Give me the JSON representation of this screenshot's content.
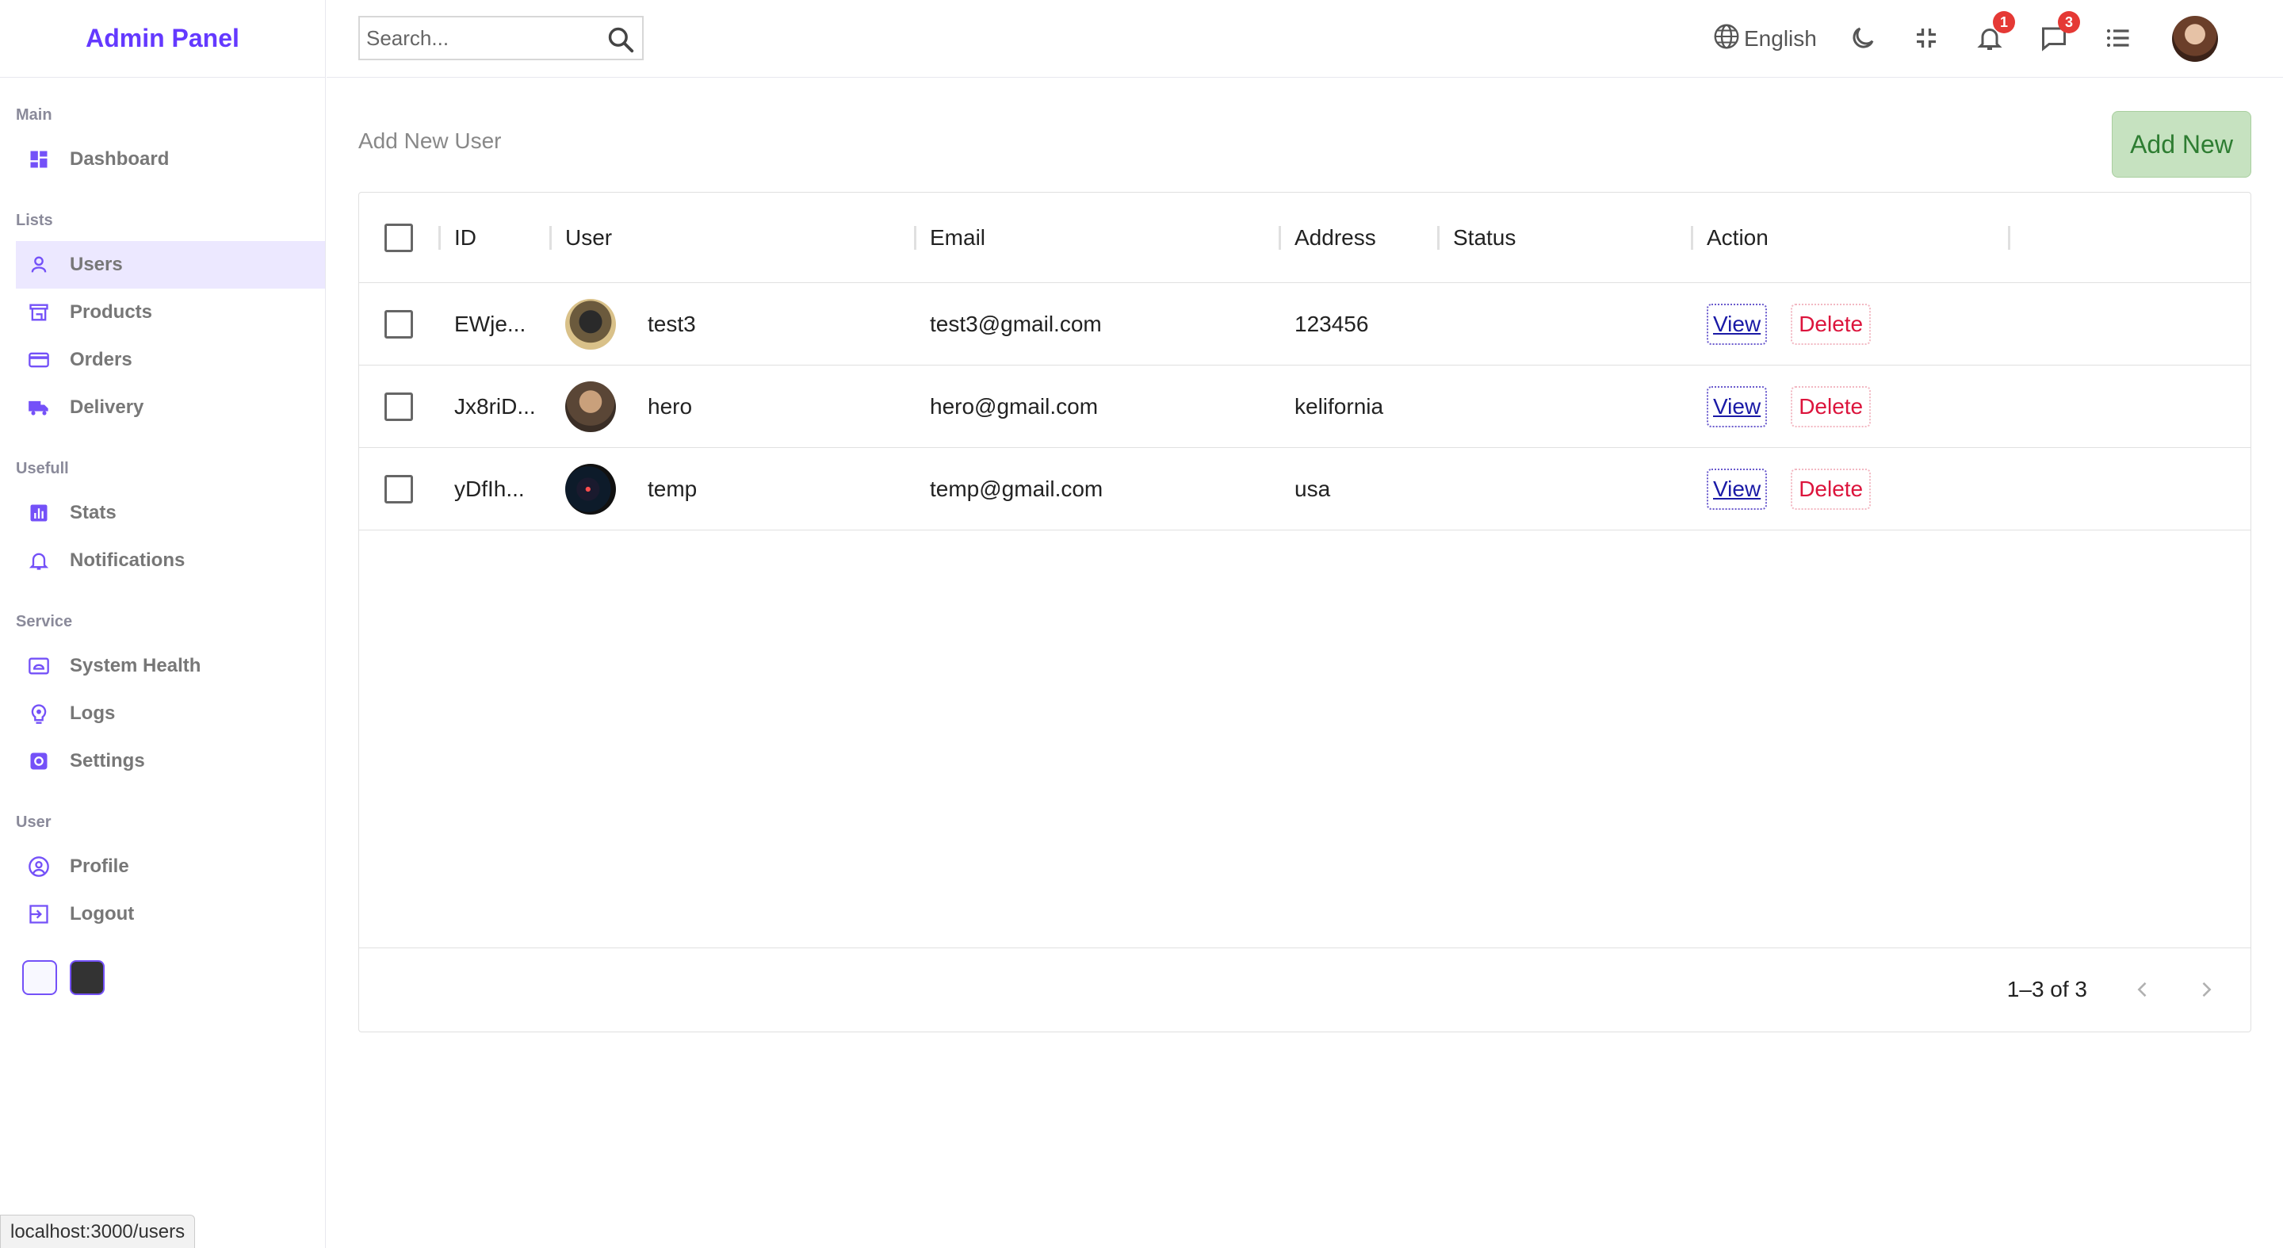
{
  "app": {
    "title": "Admin Panel"
  },
  "colors": {
    "accent": "#6439ff",
    "add_new_bg": "#c6e2c0",
    "badge": "#e53935",
    "delete": "#dc143c",
    "view": "#1a1aa6"
  },
  "sidebar": {
    "sections": [
      {
        "title": "Main",
        "items": [
          {
            "label": "Dashboard",
            "icon": "dashboard-icon"
          }
        ]
      },
      {
        "title": "Lists",
        "items": [
          {
            "label": "Users",
            "icon": "user-icon",
            "active": true
          },
          {
            "label": "Products",
            "icon": "store-icon"
          },
          {
            "label": "Orders",
            "icon": "credit-card-icon"
          },
          {
            "label": "Delivery",
            "icon": "truck-icon"
          }
        ]
      },
      {
        "title": "Usefull",
        "items": [
          {
            "label": "Stats",
            "icon": "chart-icon"
          },
          {
            "label": "Notifications",
            "icon": "bell-icon"
          }
        ]
      },
      {
        "title": "Service",
        "items": [
          {
            "label": "System Health",
            "icon": "system-health-icon"
          },
          {
            "label": "Logs",
            "icon": "logs-icon"
          },
          {
            "label": "Settings",
            "icon": "settings-icon"
          }
        ]
      },
      {
        "title": "User",
        "items": [
          {
            "label": "Profile",
            "icon": "profile-icon"
          },
          {
            "label": "Logout",
            "icon": "logout-icon"
          }
        ]
      }
    ]
  },
  "topbar": {
    "search_placeholder": "Search...",
    "language": "English",
    "notifications_count": "1",
    "messages_count": "3"
  },
  "page": {
    "title": "Add New User",
    "add_new_label": "Add New"
  },
  "table": {
    "columns": [
      "ID",
      "User",
      "Email",
      "Address",
      "Status",
      "Action"
    ],
    "rows": [
      {
        "id": "EWje...",
        "user": "test3",
        "email": "test3@gmail.com",
        "address": "123456",
        "status": ""
      },
      {
        "id": "Jx8riD...",
        "user": "hero",
        "email": "hero@gmail.com",
        "address": "kelifornia",
        "status": ""
      },
      {
        "id": "yDfIh...",
        "user": "temp",
        "email": "temp@gmail.com",
        "address": "usa",
        "status": ""
      }
    ],
    "view_label": "View",
    "delete_label": "Delete",
    "pagination": "1–3 of 3"
  },
  "status_bar": {
    "url": "localhost:3000/users"
  }
}
